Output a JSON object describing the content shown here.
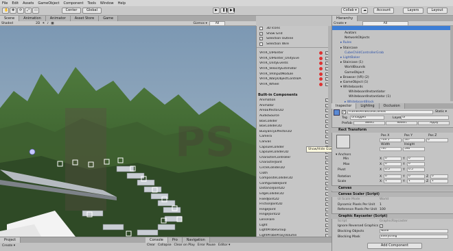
{
  "menu": [
    "File",
    "Edit",
    "Assets",
    "GameObject",
    "Component",
    "Tools",
    "Window",
    "Help"
  ],
  "toolbar": {
    "tools": [
      "✋",
      "✥",
      "⟳",
      "⤢",
      "▭"
    ],
    "center": "Center",
    "global": "Global",
    "play": "▶",
    "pause": "❚❚",
    "step": "▶❚",
    "collab": "Collab ▾",
    "account": "Account",
    "layers": "Layers",
    "layout": "Layout"
  },
  "scene_tabs": [
    "Scene",
    "Animation",
    "Animator",
    "Asset Store",
    "Game"
  ],
  "scene_bar": {
    "shading": "Shaded",
    "mode": "2D",
    "gizmos": "Gizmos ▾",
    "search": "All"
  },
  "gizmo_menu": {
    "options": [
      {
        "label": "3D Icons",
        "checked": false
      },
      {
        "label": "Show Grid",
        "checked": true
      },
      {
        "label": "Selection Outline",
        "checked": true
      },
      {
        "label": "Selection Wire",
        "checked": false
      }
    ],
    "scripts": [
      "VRTK_UIPointer",
      "VRTK_UIPointer_UnityEve",
      "VRTK_UnityEvents",
      "VRTK_VelocityEstimator",
      "VRTK_VRInputModule",
      "VRTK_WarpObjectControlA",
      "VRTK_Wheel"
    ],
    "builtin_title": "Built-in Components",
    "builtin": [
      "Animation",
      "Animator",
      "AreaEffector2D",
      "AudioSource",
      "BoxCollider",
      "BoxCollider2D",
      "BuoyancyEffector2D",
      "Camera",
      "Canvas",
      "CapsuleCollider",
      "CapsuleCollider2D",
      "CharacterController",
      "CharacterJoint",
      "CircleCollider2D",
      "Cloth",
      "CompositeCollider2D",
      "ConfigurableJoint",
      "DistanceJoint2D",
      "EdgeCollider2D",
      "FixedJoint2D",
      "FrictionJoint2D",
      "HingeJoint",
      "HingeJoint2D",
      "LensFlare",
      "Light",
      "LightProbeGroup",
      "LightProbeProxyVolume",
      "LODGroup",
      "MeshCollider",
      "NavMeshAgent"
    ],
    "tooltip": "Show/Hide Gizmos"
  },
  "hierarchy": {
    "tab": "Hierarchy",
    "create": "Create ▾",
    "search": "All",
    "items": [
      {
        "label": "Avatars",
        "indent": 2,
        "color": "#111"
      },
      {
        "label": "NetworkObjects",
        "indent": 2,
        "color": "#111"
      },
      {
        "label": "▸ Rules",
        "indent": 1,
        "color": "#2b4fa6"
      },
      {
        "label": "▸ Staircase",
        "indent": 1,
        "color": "#111"
      },
      {
        "label": "CubeChildControllerGrab",
        "indent": 2,
        "color": "#2b4fa6"
      },
      {
        "label": "▸ LightBaker",
        "indent": 1,
        "color": "#2b4fa6"
      },
      {
        "label": "▸ Staircase (1)",
        "indent": 1,
        "color": "#111"
      },
      {
        "label": "WorldBounds",
        "indent": 2,
        "color": "#111"
      },
      {
        "label": "GameObject",
        "indent": 2,
        "color": "#111"
      },
      {
        "label": "▸ Browser (VR) (2)",
        "indent": 1,
        "color": "#111"
      },
      {
        "label": "▸ GameObject (1)",
        "indent": 1,
        "color": "#111"
      },
      {
        "label": "▾ Whiteboards",
        "indent": 1,
        "color": "#111"
      },
      {
        "label": "WhiteboardInstantiator",
        "indent": 3,
        "color": "#111"
      },
      {
        "label": "WhiteboardInstantiator (1)",
        "indent": 3,
        "color": "#111"
      },
      {
        "label": "▸ WhiteboardBlock",
        "indent": 2,
        "color": "#2b4fa6"
      },
      {
        "label": "▸ [Basic] Information panel block (1)",
        "indent": 2,
        "color": "#2b4fa6"
      }
    ]
  },
  "inspector": {
    "tabs": [
      "Inspector",
      "Lighting",
      "Occlusion"
    ],
    "object_name": "FramesPerSecondCanvas",
    "static": "Static ▾",
    "tag_label": "Tag",
    "tag": "Untagged",
    "layer_label": "Layer",
    "layer": "UI",
    "prefab_label": "Prefab",
    "prefab_buttons": [
      "Select",
      "Revert",
      "Apply"
    ],
    "rect_transform": "Rect Transform",
    "pos_headers": [
      "Pos X",
      "Pos Y",
      "Pos Z"
    ],
    "pos_values": [
      "749.5",
      "507",
      "0"
    ],
    "size_headers": [
      "Width",
      "Height"
    ],
    "size_values": [
      "797",
      "596"
    ],
    "anchors_label": "▾ Anchors",
    "min_label": "Min",
    "min": [
      "0",
      "0"
    ],
    "max_label": "Max",
    "max": [
      "0",
      "0"
    ],
    "pivot_label": "Pivot",
    "pivot": [
      "0.5",
      "0.5"
    ],
    "rotation_label": "Rotation",
    "rotation": [
      "0",
      "0",
      "0"
    ],
    "scale_label": "Scale",
    "scale": [
      "1",
      "1",
      "1"
    ],
    "xyz": [
      "X",
      "Y",
      "Z"
    ],
    "canvas": "Canvas",
    "canvas_scaler": "Canvas Scaler (Script)",
    "ui_scale_label": "UI Scale Mode",
    "ui_scale": "World",
    "dyn_label": "Dynamic Pixels Per Unit",
    "dyn_value": "1",
    "ref_label": "Reference Pixels Per Unit",
    "ref_value": "100",
    "raycaster": "Graphic Raycaster (Script)",
    "script_label": "Script",
    "script_value": "GraphicRaycaster",
    "ignore_label": "Ignore Reversed Graphics",
    "blocking_label": "Blocking Objects",
    "blocking_value": "None",
    "mask_label": "Blocking Mask",
    "mask_value": "Everything",
    "add_component": "Add Component"
  },
  "bottom": {
    "project_tab": "Project",
    "create": "Create ▾",
    "console_tab": "Console",
    "pro_tab": "Pro",
    "navigation_tab": "Navigation",
    "clear": "Clear",
    "collapse": "Collapse",
    "clear_on_play": "Clear on Play",
    "error_pause": "Error Pause",
    "editor": "Editor ▾"
  },
  "colors": {
    "selection": "#3d7ed6",
    "hierarchy_link": "#2b4fa6"
  }
}
